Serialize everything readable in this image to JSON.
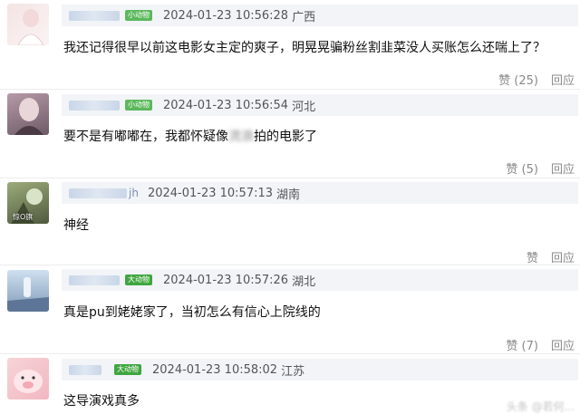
{
  "comments": [
    {
      "user_name": "",
      "user_suffix": "",
      "badge": "小动物",
      "time": "2024-01-23 10:56:28",
      "location": "广西",
      "text_before": "我还记得很早以前这电影女主定的爽子，明晃晃骗粉丝割韭菜没人买账怎么还喘上了？",
      "text_blur": "",
      "text_after": "",
      "like": "赞 (25)",
      "reply": "回应",
      "avatar_colors": [
        "#f4e4e4",
        "#fbf3f3"
      ]
    },
    {
      "user_name": "",
      "user_suffix": "",
      "badge": "小动物",
      "time": "2024-01-23 10:56:54",
      "location": "河北",
      "text_before": "要不是有嘟嘟在，我都怀疑像",
      "text_blur": "流浪",
      "text_after": "拍的电影了",
      "like": "赞 (5)",
      "reply": "回应",
      "avatar_colors": [
        "#b79aa8",
        "#6d5a66"
      ]
    },
    {
      "user_name": "",
      "user_suffix": "jh",
      "badge": "",
      "time": "2024-01-23 10:57:13",
      "location": "湖南",
      "text_before": "神经",
      "text_blur": "",
      "text_after": "",
      "like": "赞",
      "reply": "回应",
      "avatar_colors": [
        "#9cab7a",
        "#4f5a3e"
      ],
      "avatar_text": "惊O旗"
    },
    {
      "user_name": "",
      "user_suffix": "",
      "badge": "大动物",
      "time": "2024-01-23 10:57:26",
      "location": "湖北",
      "text_before": "真是pu到姥姥家了，当初怎么有信心上院线的",
      "text_blur": "",
      "text_after": "",
      "like": "赞 (7)",
      "reply": "回应",
      "avatar_colors": [
        "#cfe0f0",
        "#7f9ab8"
      ]
    },
    {
      "user_name": "",
      "user_suffix": "",
      "badge": "大动物",
      "time": "2024-01-23 10:58:02",
      "location": "江苏",
      "text_before": "这导演戏真多",
      "text_blur": "",
      "text_after": "",
      "like": "",
      "reply": "",
      "avatar_colors": [
        "#f6d4d8",
        "#f2b7c0"
      ]
    }
  ],
  "watermark": "头条 @若何..."
}
